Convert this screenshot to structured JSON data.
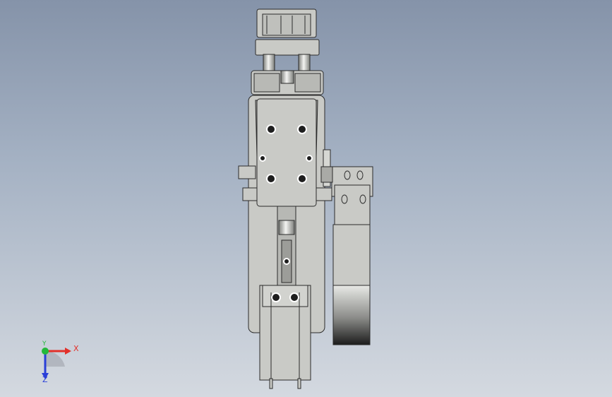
{
  "viewport": {
    "background_top": "#8593a9",
    "background_bottom": "#d4d9e0"
  },
  "model": {
    "part_color": "#c9cac6",
    "edge_color": "#2b2b2b",
    "shadow_color": "#9fa19b",
    "rod_highlight": "#f2f2f2",
    "hole_color": "#1e1e1e"
  },
  "triad": {
    "x_label": "X",
    "y_label": "Y",
    "z_label": "Z",
    "x_color": "#e2302a",
    "y_color": "#23b83a",
    "z_color": "#2a3fd8"
  }
}
